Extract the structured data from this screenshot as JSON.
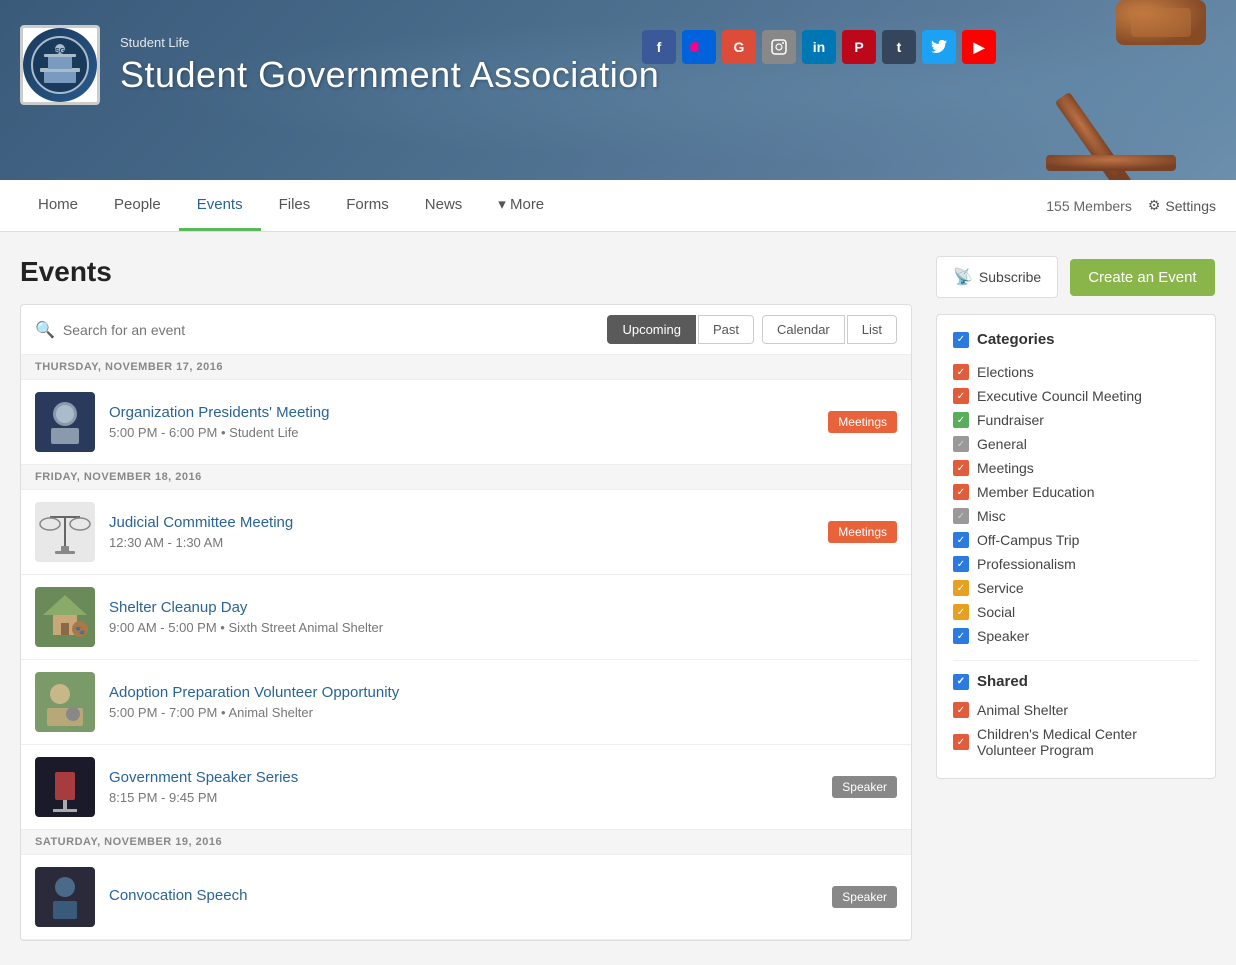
{
  "header": {
    "subtitle": "Student Life",
    "title": "Student Government Association",
    "members_count": "155 Members",
    "settings_label": "Settings"
  },
  "social_icons": [
    {
      "name": "facebook-icon",
      "label": "f",
      "color": "#3b5998"
    },
    {
      "name": "flickr-icon",
      "label": "✿",
      "color": "#ff0084"
    },
    {
      "name": "google-icon",
      "label": "G",
      "color": "#dd4b39"
    },
    {
      "name": "instagram-icon",
      "label": "📷",
      "color": "#c13584"
    },
    {
      "name": "linkedin-icon",
      "label": "in",
      "color": "#0077b5"
    },
    {
      "name": "pinterest-icon",
      "label": "P",
      "color": "#bd081c"
    },
    {
      "name": "tumblr-icon",
      "label": "t",
      "color": "#35465c"
    },
    {
      "name": "twitter-icon",
      "label": "🐦",
      "color": "#1da1f2"
    },
    {
      "name": "youtube-icon",
      "label": "▶",
      "color": "#ff0000"
    }
  ],
  "nav": {
    "links": [
      {
        "label": "Home",
        "active": false
      },
      {
        "label": "People",
        "active": false
      },
      {
        "label": "Events",
        "active": true
      },
      {
        "label": "Files",
        "active": false
      },
      {
        "label": "Forms",
        "active": false
      },
      {
        "label": "News",
        "active": false
      },
      {
        "label": "More",
        "active": false,
        "has_arrow": true
      }
    ]
  },
  "events_page": {
    "title": "Events",
    "search_placeholder": "Search for an event",
    "filter_upcoming": "Upcoming",
    "filter_past": "Past",
    "view_calendar": "Calendar",
    "view_list": "List",
    "subscribe_label": "Subscribe",
    "create_event_label": "Create an Event",
    "dates": [
      {
        "label": "THURSDAY, NOVEMBER 17, 2016",
        "events": [
          {
            "id": "org-presidents-meeting",
            "title": "Organization Presidents' Meeting",
            "time": "5:00 PM - 6:00 PM",
            "location": "Student Life",
            "badge": "Meetings",
            "badge_class": "badge-meetings",
            "thumb_type": "presidential"
          }
        ]
      },
      {
        "label": "FRIDAY, NOVEMBER 18, 2016",
        "events": [
          {
            "id": "judicial-committee-meeting",
            "title": "Judicial Committee Meeting",
            "time": "12:30 AM - 1:30 AM",
            "location": "",
            "badge": "Meetings",
            "badge_class": "badge-meetings",
            "thumb_type": "scales"
          },
          {
            "id": "shelter-cleanup-day",
            "title": "Shelter Cleanup Day",
            "time": "9:00 AM - 5:00 PM",
            "location": "Sixth Street Animal Shelter",
            "badge": "",
            "badge_class": "",
            "thumb_type": "shelter"
          },
          {
            "id": "adoption-prep-volunteer",
            "title": "Adoption Preparation Volunteer Opportunity",
            "time": "5:00 PM - 7:00 PM",
            "location": "Animal Shelter",
            "badge": "",
            "badge_class": "",
            "thumb_type": "adoption"
          },
          {
            "id": "government-speaker-series",
            "title": "Government Speaker Series",
            "time": "8:15 PM - 9:45 PM",
            "location": "",
            "badge": "Speaker",
            "badge_class": "badge-speaker",
            "thumb_type": "speaker"
          }
        ]
      },
      {
        "label": "SATURDAY, NOVEMBER 19, 2016",
        "events": [
          {
            "id": "convocation-speech",
            "title": "Convocation Speech",
            "time": "",
            "location": "",
            "badge": "Speaker",
            "badge_class": "badge-speaker",
            "thumb_type": "convocation"
          }
        ]
      }
    ]
  },
  "categories": {
    "title": "Categories",
    "items": [
      {
        "label": "Elections",
        "cb_class": "cb-red"
      },
      {
        "label": "Executive Council Meeting",
        "cb_class": "cb-red"
      },
      {
        "label": "Fundraiser",
        "cb_class": "cb-green"
      },
      {
        "label": "General",
        "cb_class": "cb-gray"
      },
      {
        "label": "Meetings",
        "cb_class": "cb-red"
      },
      {
        "label": "Member Education",
        "cb_class": "cb-red"
      },
      {
        "label": "Misc",
        "cb_class": "cb-gray"
      },
      {
        "label": "Off-Campus Trip",
        "cb_class": "cb-blue"
      },
      {
        "label": "Professionalism",
        "cb_class": "cb-blue"
      },
      {
        "label": "Service",
        "cb_class": "cb-orange"
      },
      {
        "label": "Social",
        "cb_class": "cb-orange"
      },
      {
        "label": "Speaker",
        "cb_class": "cb-blue"
      }
    ]
  },
  "shared": {
    "title": "Shared",
    "items": [
      {
        "label": "Animal Shelter",
        "cb_class": "cb-red"
      },
      {
        "label": "Children's Medical Center Volunteer Program",
        "cb_class": "cb-red"
      }
    ]
  }
}
